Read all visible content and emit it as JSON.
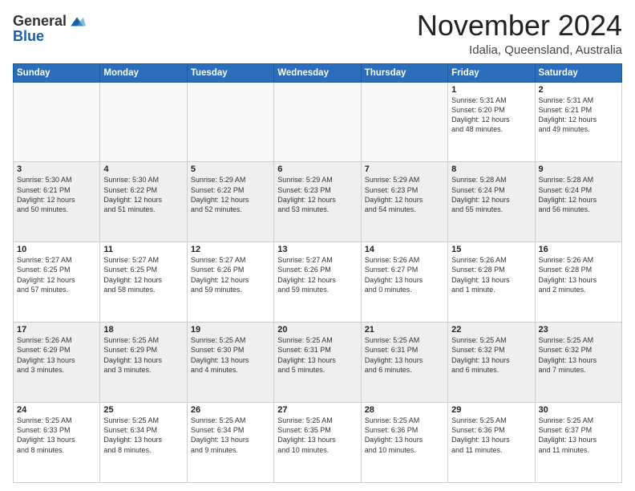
{
  "logo": {
    "general": "General",
    "blue": "Blue"
  },
  "title": "November 2024",
  "location": "Idalia, Queensland, Australia",
  "days_header": [
    "Sunday",
    "Monday",
    "Tuesday",
    "Wednesday",
    "Thursday",
    "Friday",
    "Saturday"
  ],
  "weeks": [
    [
      {
        "day": "",
        "info": ""
      },
      {
        "day": "",
        "info": ""
      },
      {
        "day": "",
        "info": ""
      },
      {
        "day": "",
        "info": ""
      },
      {
        "day": "",
        "info": ""
      },
      {
        "day": "1",
        "info": "Sunrise: 5:31 AM\nSunset: 6:20 PM\nDaylight: 12 hours\nand 48 minutes."
      },
      {
        "day": "2",
        "info": "Sunrise: 5:31 AM\nSunset: 6:21 PM\nDaylight: 12 hours\nand 49 minutes."
      }
    ],
    [
      {
        "day": "3",
        "info": "Sunrise: 5:30 AM\nSunset: 6:21 PM\nDaylight: 12 hours\nand 50 minutes."
      },
      {
        "day": "4",
        "info": "Sunrise: 5:30 AM\nSunset: 6:22 PM\nDaylight: 12 hours\nand 51 minutes."
      },
      {
        "day": "5",
        "info": "Sunrise: 5:29 AM\nSunset: 6:22 PM\nDaylight: 12 hours\nand 52 minutes."
      },
      {
        "day": "6",
        "info": "Sunrise: 5:29 AM\nSunset: 6:23 PM\nDaylight: 12 hours\nand 53 minutes."
      },
      {
        "day": "7",
        "info": "Sunrise: 5:29 AM\nSunset: 6:23 PM\nDaylight: 12 hours\nand 54 minutes."
      },
      {
        "day": "8",
        "info": "Sunrise: 5:28 AM\nSunset: 6:24 PM\nDaylight: 12 hours\nand 55 minutes."
      },
      {
        "day": "9",
        "info": "Sunrise: 5:28 AM\nSunset: 6:24 PM\nDaylight: 12 hours\nand 56 minutes."
      }
    ],
    [
      {
        "day": "10",
        "info": "Sunrise: 5:27 AM\nSunset: 6:25 PM\nDaylight: 12 hours\nand 57 minutes."
      },
      {
        "day": "11",
        "info": "Sunrise: 5:27 AM\nSunset: 6:25 PM\nDaylight: 12 hours\nand 58 minutes."
      },
      {
        "day": "12",
        "info": "Sunrise: 5:27 AM\nSunset: 6:26 PM\nDaylight: 12 hours\nand 59 minutes."
      },
      {
        "day": "13",
        "info": "Sunrise: 5:27 AM\nSunset: 6:26 PM\nDaylight: 12 hours\nand 59 minutes."
      },
      {
        "day": "14",
        "info": "Sunrise: 5:26 AM\nSunset: 6:27 PM\nDaylight: 13 hours\nand 0 minutes."
      },
      {
        "day": "15",
        "info": "Sunrise: 5:26 AM\nSunset: 6:28 PM\nDaylight: 13 hours\nand 1 minute."
      },
      {
        "day": "16",
        "info": "Sunrise: 5:26 AM\nSunset: 6:28 PM\nDaylight: 13 hours\nand 2 minutes."
      }
    ],
    [
      {
        "day": "17",
        "info": "Sunrise: 5:26 AM\nSunset: 6:29 PM\nDaylight: 13 hours\nand 3 minutes."
      },
      {
        "day": "18",
        "info": "Sunrise: 5:25 AM\nSunset: 6:29 PM\nDaylight: 13 hours\nand 3 minutes."
      },
      {
        "day": "19",
        "info": "Sunrise: 5:25 AM\nSunset: 6:30 PM\nDaylight: 13 hours\nand 4 minutes."
      },
      {
        "day": "20",
        "info": "Sunrise: 5:25 AM\nSunset: 6:31 PM\nDaylight: 13 hours\nand 5 minutes."
      },
      {
        "day": "21",
        "info": "Sunrise: 5:25 AM\nSunset: 6:31 PM\nDaylight: 13 hours\nand 6 minutes."
      },
      {
        "day": "22",
        "info": "Sunrise: 5:25 AM\nSunset: 6:32 PM\nDaylight: 13 hours\nand 6 minutes."
      },
      {
        "day": "23",
        "info": "Sunrise: 5:25 AM\nSunset: 6:32 PM\nDaylight: 13 hours\nand 7 minutes."
      }
    ],
    [
      {
        "day": "24",
        "info": "Sunrise: 5:25 AM\nSunset: 6:33 PM\nDaylight: 13 hours\nand 8 minutes."
      },
      {
        "day": "25",
        "info": "Sunrise: 5:25 AM\nSunset: 6:34 PM\nDaylight: 13 hours\nand 8 minutes."
      },
      {
        "day": "26",
        "info": "Sunrise: 5:25 AM\nSunset: 6:34 PM\nDaylight: 13 hours\nand 9 minutes."
      },
      {
        "day": "27",
        "info": "Sunrise: 5:25 AM\nSunset: 6:35 PM\nDaylight: 13 hours\nand 10 minutes."
      },
      {
        "day": "28",
        "info": "Sunrise: 5:25 AM\nSunset: 6:36 PM\nDaylight: 13 hours\nand 10 minutes."
      },
      {
        "day": "29",
        "info": "Sunrise: 5:25 AM\nSunset: 6:36 PM\nDaylight: 13 hours\nand 11 minutes."
      },
      {
        "day": "30",
        "info": "Sunrise: 5:25 AM\nSunset: 6:37 PM\nDaylight: 13 hours\nand 11 minutes."
      }
    ]
  ]
}
